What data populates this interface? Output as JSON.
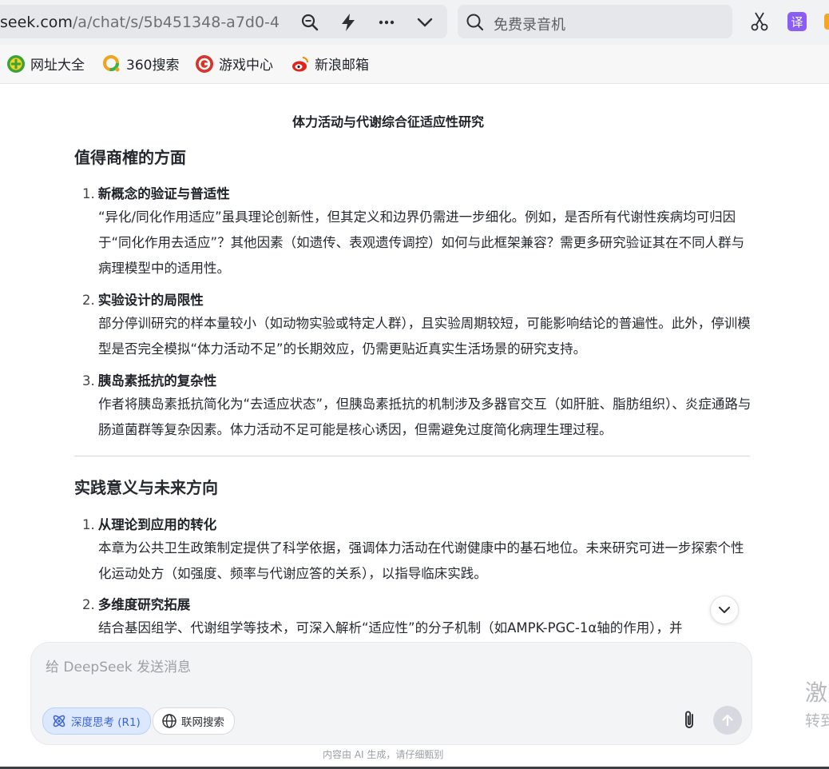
{
  "browser": {
    "url_main": "seek.com",
    "url_path": "/a/chat/s/5b451348-a7d0-4",
    "search_placeholder": "免费录音机",
    "icons": [
      "zoom-icon",
      "lightning-icon",
      "more-icon",
      "chevron-down-icon",
      "search-icon",
      "scissors-icon",
      "translate-icon"
    ],
    "translate_badge": "译"
  },
  "bookmarks": [
    {
      "label": "网址大全",
      "icon": "plus-circle-icon",
      "color": "#3aa33a"
    },
    {
      "label": "360搜索",
      "icon": "search-ring-icon",
      "color": "#f2a31b"
    },
    {
      "label": "游戏中心",
      "icon": "game-icon",
      "color": "#d9342b"
    },
    {
      "label": "新浪邮箱",
      "icon": "sina-icon",
      "color": "#e2231a"
    }
  ],
  "content": {
    "title": "体力活动与代谢综合征适应性研究",
    "section1": {
      "heading": "值得商榷的方面",
      "items": [
        {
          "num": "1.",
          "title": "新概念的验证与普适性",
          "body": "“异化/同化作用适应”虽具理论创新性，但其定义和边界仍需进一步细化。例如，是否所有代谢性疾病均可归因于“同化作用去适应”？其他因素（如遗传、表观遗传调控）如何与此框架兼容？需更多研究验证其在不同人群与病理模型中的适用性。"
        },
        {
          "num": "2.",
          "title": "实验设计的局限性",
          "body": "部分停训研究的样本量较小（如动物实验或特定人群），且实验周期较短，可能影响结论的普遍性。此外，停训模型是否完全模拟“体力活动不足”的长期效应，仍需更贴近真实生活场景的研究支持。"
        },
        {
          "num": "3.",
          "title": "胰岛素抵抗的复杂性",
          "body": "作者将胰岛素抵抗简化为“去适应状态”，但胰岛素抵抗的机制涉及多器官交互（如肝脏、脂肪组织）、炎症通路与肠道菌群等复杂因素。体力活动不足可能是核心诱因，但需避免过度简化病理生理过程。"
        }
      ]
    },
    "section2": {
      "heading": "实践意义与未来方向",
      "items": [
        {
          "num": "1.",
          "title": "从理论到应用的转化",
          "body": "本章为公共卫生政策制定提供了科学依据，强调体力活动在代谢健康中的基石地位。未来研究可进一步探索个性化运动处方（如强度、频率与代谢应答的关系），以指导临床实践。"
        },
        {
          "num": "2.",
          "title": "多维度研究拓展",
          "body": "结合基因组学、代谢组学等技术，可深入解析“适应性”的分子机制（如AMPK-PGC-1α轴的作用），并"
        }
      ]
    }
  },
  "composer": {
    "placeholder": "给 DeepSeek 发送消息",
    "deep_think_label": "深度思考 (R1)",
    "web_search_label": "联网搜索"
  },
  "footer": {
    "note": "内容由 AI 生成，请仔细甄别"
  },
  "side_partial": {
    "line1": "激",
    "line2": "转到"
  }
}
